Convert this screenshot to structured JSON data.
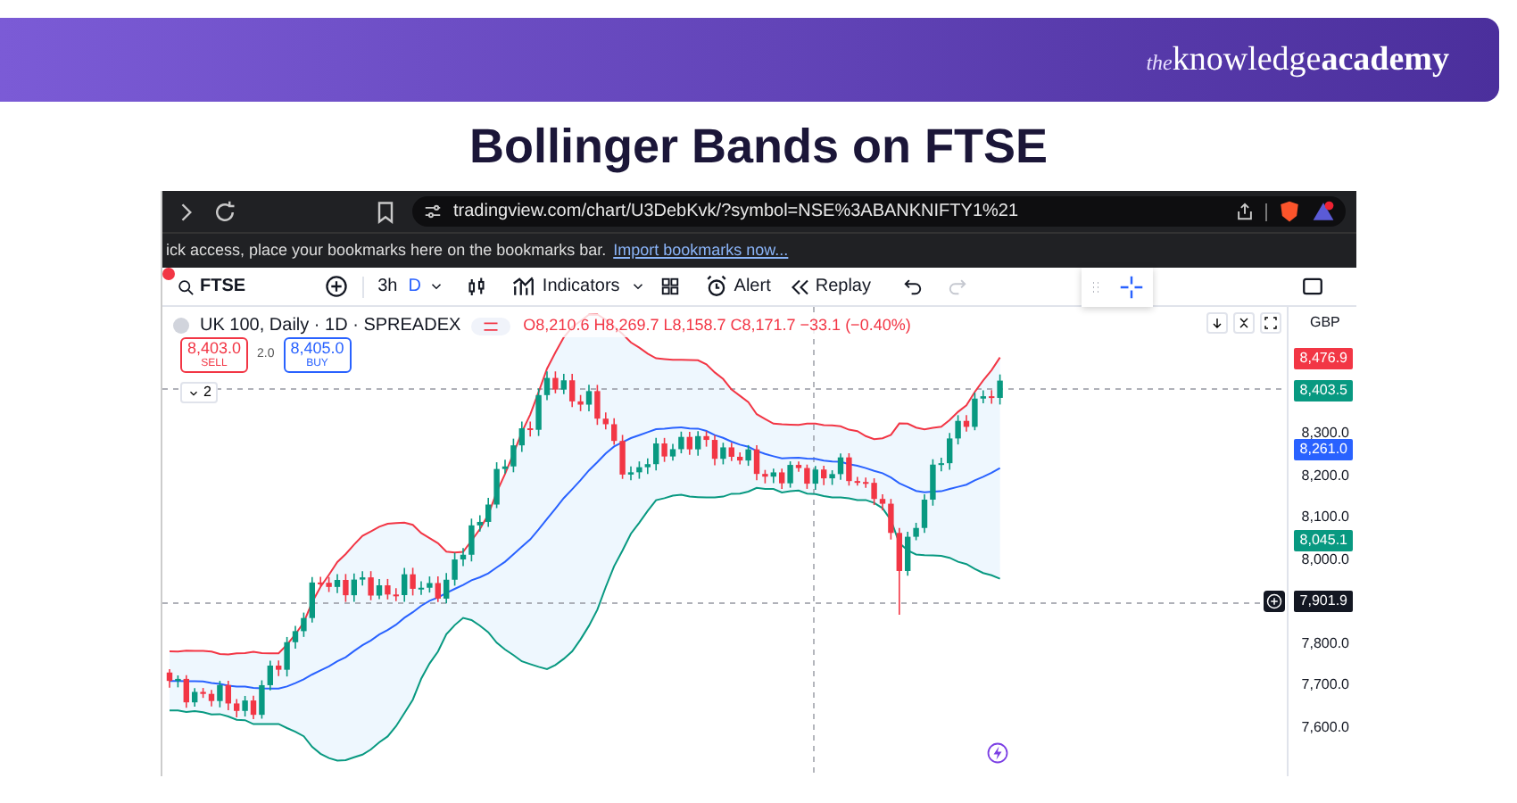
{
  "banner": {
    "logo_prefix": "the",
    "logo_main": "knowledge",
    "logo_suffix": "academy"
  },
  "title": "Bollinger Bands on FTSE",
  "browser": {
    "url": "tradingview.com/chart/U3DebKvk/?symbol=NSE%3ABANKNIFTY1%21",
    "bookmarks_text": "ick access, place your bookmarks here on the bookmarks bar.",
    "bookmarks_link": "Import bookmarks now..."
  },
  "toolbar": {
    "symbol": "FTSE",
    "interval": "3h",
    "selected_interval": "D",
    "indicators": "Indicators",
    "alert": "Alert",
    "replay": "Replay"
  },
  "chart": {
    "legend": "UK 100, Daily · 1D · SPREADEX",
    "ohlc": "O8,210.6 H8,269.7 L8,158.7 C8,171.7 −33.1 (−0.40%)",
    "sell": {
      "price": "8,403.0",
      "label": "SELL"
    },
    "spread": "2.0",
    "buy": {
      "price": "8,405.0",
      "label": "BUY"
    },
    "collapsed_count": "2",
    "currency": "GBP",
    "axis_labels": [
      "8,300.0",
      "8,200.0",
      "8,100.0",
      "8,000.0",
      "7,800.0",
      "7,700.0",
      "7,600.0"
    ],
    "price_tags": [
      {
        "price": "8,476.9",
        "color": "#f23645"
      },
      {
        "price": "8,403.5",
        "color": "#089981"
      },
      {
        "price": "8,261.0",
        "color": "#2962ff"
      },
      {
        "price": "8,045.1",
        "color": "#089981"
      },
      {
        "price": "7,901.9",
        "color": "#131722"
      }
    ]
  }
}
